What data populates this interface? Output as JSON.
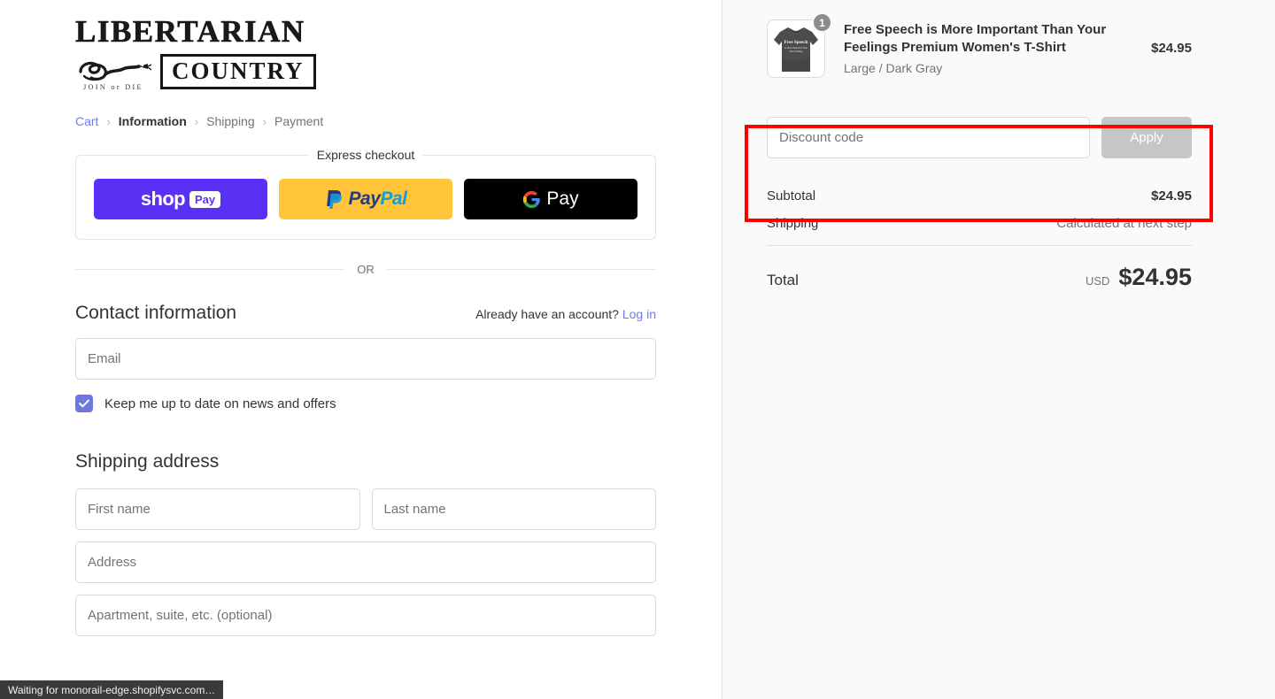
{
  "brand": {
    "line1": "LIBERTARIAN",
    "line2": "COUNTRY",
    "tagline": "JOIN or DIE"
  },
  "breadcrumb": {
    "items": [
      {
        "label": "Cart",
        "state": "link"
      },
      {
        "label": "Information",
        "state": "active"
      },
      {
        "label": "Shipping",
        "state": "muted"
      },
      {
        "label": "Payment",
        "state": "muted"
      }
    ],
    "separator": "›"
  },
  "express": {
    "legend": "Express checkout",
    "buttons": [
      {
        "name": "shop-pay",
        "label": "shop",
        "badge": "Pay",
        "color": "#5a31f4"
      },
      {
        "name": "paypal",
        "label_1": "Pay",
        "label_2": "Pal",
        "color": "#ffc439"
      },
      {
        "name": "google-pay",
        "label": "Pay",
        "color": "#000000"
      }
    ]
  },
  "divider": {
    "or": "OR"
  },
  "contact": {
    "title": "Contact information",
    "account_prompt": "Already have an account?",
    "login_label": "Log in",
    "email_placeholder": "Email",
    "email_value": "",
    "newsletter_label": "Keep me up to date on news and offers",
    "newsletter_checked": true,
    "checkbox_color": "#6c78e0"
  },
  "shipping_address": {
    "title": "Shipping address",
    "fields": [
      {
        "name": "first-name",
        "placeholder": "First name",
        "value": ""
      },
      {
        "name": "last-name",
        "placeholder": "Last name",
        "value": ""
      },
      {
        "name": "address",
        "placeholder": "Address",
        "value": ""
      },
      {
        "name": "apartment",
        "placeholder": "Apartment, suite, etc. (optional)",
        "value": ""
      }
    ]
  },
  "summary": {
    "line_item": {
      "quantity": "1",
      "title": "Free Speech is More Important Than Your Feelings Premium Women's T-Shirt",
      "variant": "Large / Dark Gray",
      "price": "$24.95",
      "thumb_text_line1": "Free Speech",
      "thumb_text_line2": "is More Important Than",
      "thumb_text_line3": "Your Feelings"
    },
    "discount": {
      "placeholder": "Discount code",
      "value": "",
      "apply_label": "Apply",
      "highlight_color": "#ff0000"
    },
    "subtotal_label": "Subtotal",
    "subtotal_value": "$24.95",
    "shipping_label": "Shipping",
    "shipping_value": "Calculated at next step",
    "total_label": "Total",
    "total_currency": "USD",
    "total_value": "$24.95"
  },
  "status_bar": {
    "text": "Waiting for monorail-edge.shopifysvc.com…"
  }
}
